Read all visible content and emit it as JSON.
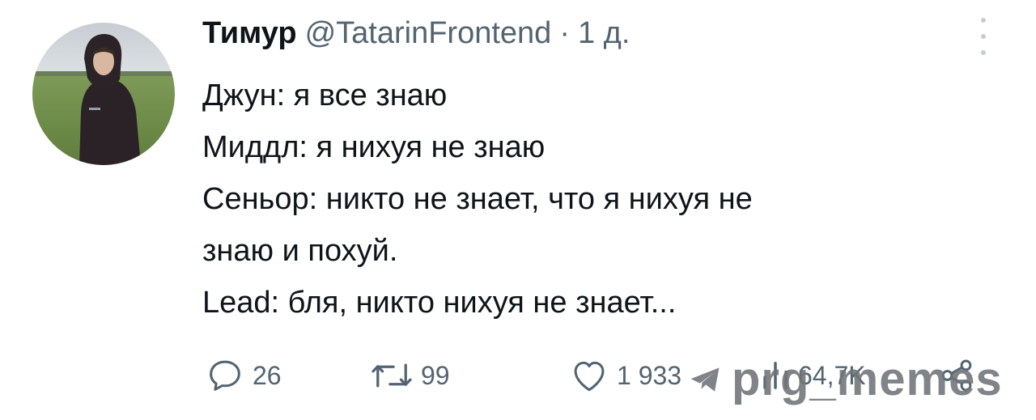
{
  "tweet": {
    "author": {
      "name": "Тимур",
      "handle": "@TatarinFrontend"
    },
    "separator": "·",
    "time": "1 д.",
    "lines": [
      "Джун: я все знаю",
      "Миддл: я нихуя не знаю",
      "Сеньор: никто не знает, что я нихуя не",
      "знаю и похуй.",
      "Lead: бля, никто нихуя не знает..."
    ],
    "metrics": {
      "replies": "26",
      "retweets": "99",
      "likes": "1 933",
      "views": "64,7K"
    }
  },
  "watermark": {
    "text": "prg_memes"
  },
  "colors": {
    "text": "#0f1419",
    "secondary": "#536471",
    "watermark": "#6f7377"
  }
}
